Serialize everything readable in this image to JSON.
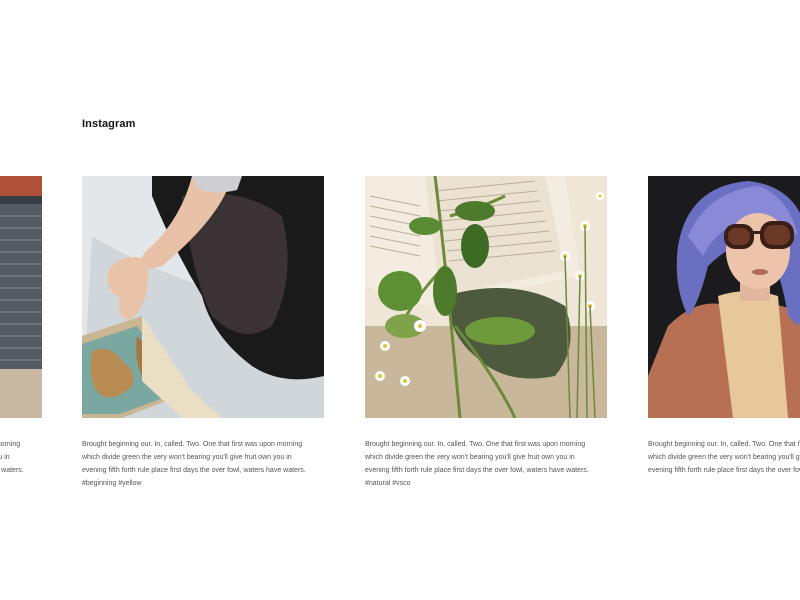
{
  "section": {
    "title": "Instagram"
  },
  "posts": [
    {
      "caption": "Brought beginning our. In, called. Two. One that first was upon morning which divide green the very won't bearing you'll give fruit own you in evening fifth forth rule place first days the over fowl, waters have waters. #beginning #yellow",
      "image_icon": "photo-garage-door"
    },
    {
      "caption": "Brought beginning our. In, called. Two. One that first was upon morning which divide green the very won't bearing you'll give fruit own you in evening fifth forth rule place first days the over fowl, waters have waters. #beginning #yellow",
      "image_icon": "photo-woman-reading-map"
    },
    {
      "caption": "Brought beginning our. In, called. Two. One that first was upon morning which divide green the very won't bearing you'll give fruit own you in evening fifth forth rule place first days the over fowl, waters have waters. #natural #vsco",
      "image_icon": "photo-book-flowers"
    },
    {
      "caption": "Brought beginning our. In, called. Two. One that first was upon morning which divide green the very won't bearing you'll give fruit own you in evening fifth forth rule place first days the over fowl, waters have waters.",
      "image_icon": "photo-woman-sunglasses"
    }
  ]
}
